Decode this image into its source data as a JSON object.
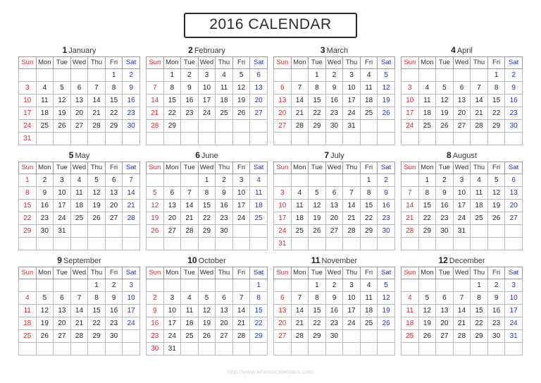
{
  "title": "2016 CALENDAR",
  "year": 2016,
  "colors": {
    "sunday": "#e8232a",
    "saturday": "#2430c8",
    "weekday": "#222222",
    "border": "#b8b8b8",
    "frame": "#2b2b2b",
    "footer": "#cfcfcf"
  },
  "weekday_headers": [
    "Sun",
    "Mon",
    "Tue",
    "Wed",
    "Thu",
    "Fri",
    "Sat"
  ],
  "footer": {
    "url": "http://www.wheniscalendars.com"
  },
  "months": [
    {
      "number": "1",
      "name": "January",
      "first_weekday": 5,
      "days_in_month": 31,
      "weeks": [
        [
          "",
          "",
          "",
          "",
          "",
          "1",
          "2"
        ],
        [
          "3",
          "4",
          "5",
          "6",
          "7",
          "8",
          "9"
        ],
        [
          "10",
          "11",
          "12",
          "13",
          "14",
          "15",
          "16"
        ],
        [
          "17",
          "18",
          "19",
          "20",
          "21",
          "22",
          "23"
        ],
        [
          "24",
          "25",
          "26",
          "27",
          "28",
          "29",
          "30"
        ],
        [
          "31",
          "",
          "",
          "",
          "",
          "",
          ""
        ]
      ]
    },
    {
      "number": "2",
      "name": "February",
      "first_weekday": 1,
      "days_in_month": 29,
      "weeks": [
        [
          "",
          "1",
          "2",
          "3",
          "4",
          "5",
          "6"
        ],
        [
          "7",
          "8",
          "9",
          "10",
          "11",
          "12",
          "13"
        ],
        [
          "14",
          "15",
          "16",
          "17",
          "18",
          "19",
          "20"
        ],
        [
          "21",
          "22",
          "23",
          "24",
          "25",
          "26",
          "27"
        ],
        [
          "28",
          "29",
          "",
          "",
          "",
          "",
          ""
        ],
        [
          "",
          "",
          "",
          "",
          "",
          "",
          ""
        ]
      ]
    },
    {
      "number": "3",
      "name": "March",
      "first_weekday": 2,
      "days_in_month": 31,
      "weeks": [
        [
          "",
          "",
          "1",
          "2",
          "3",
          "4",
          "5"
        ],
        [
          "6",
          "7",
          "8",
          "9",
          "10",
          "11",
          "12"
        ],
        [
          "13",
          "14",
          "15",
          "16",
          "17",
          "18",
          "19"
        ],
        [
          "20",
          "21",
          "22",
          "23",
          "24",
          "25",
          "26"
        ],
        [
          "27",
          "28",
          "29",
          "30",
          "31",
          "",
          ""
        ],
        [
          "",
          "",
          "",
          "",
          "",
          "",
          ""
        ]
      ]
    },
    {
      "number": "4",
      "name": "April",
      "first_weekday": 5,
      "days_in_month": 30,
      "weeks": [
        [
          "",
          "",
          "",
          "",
          "",
          "1",
          "2"
        ],
        [
          "3",
          "4",
          "5",
          "6",
          "7",
          "8",
          "9"
        ],
        [
          "10",
          "11",
          "12",
          "13",
          "14",
          "15",
          "16"
        ],
        [
          "17",
          "18",
          "19",
          "20",
          "21",
          "22",
          "23"
        ],
        [
          "24",
          "25",
          "26",
          "27",
          "28",
          "29",
          "30"
        ],
        [
          "",
          "",
          "",
          "",
          "",
          "",
          ""
        ]
      ]
    },
    {
      "number": "5",
      "name": "May",
      "first_weekday": 0,
      "days_in_month": 31,
      "weeks": [
        [
          "1",
          "2",
          "3",
          "4",
          "5",
          "6",
          "7"
        ],
        [
          "8",
          "9",
          "10",
          "11",
          "12",
          "13",
          "14"
        ],
        [
          "15",
          "16",
          "17",
          "18",
          "19",
          "20",
          "21"
        ],
        [
          "22",
          "23",
          "24",
          "25",
          "26",
          "27",
          "28"
        ],
        [
          "29",
          "30",
          "31",
          "",
          "",
          "",
          ""
        ],
        [
          "",
          "",
          "",
          "",
          "",
          "",
          ""
        ]
      ]
    },
    {
      "number": "6",
      "name": "June",
      "first_weekday": 3,
      "days_in_month": 30,
      "weeks": [
        [
          "",
          "",
          "",
          "1",
          "2",
          "3",
          "4"
        ],
        [
          "5",
          "6",
          "7",
          "8",
          "9",
          "10",
          "11"
        ],
        [
          "12",
          "13",
          "14",
          "15",
          "16",
          "17",
          "18"
        ],
        [
          "19",
          "20",
          "21",
          "22",
          "23",
          "24",
          "25"
        ],
        [
          "26",
          "27",
          "28",
          "29",
          "30",
          "",
          ""
        ],
        [
          "",
          "",
          "",
          "",
          "",
          "",
          ""
        ]
      ]
    },
    {
      "number": "7",
      "name": "July",
      "first_weekday": 5,
      "days_in_month": 31,
      "weeks": [
        [
          "",
          "",
          "",
          "",
          "",
          "1",
          "2"
        ],
        [
          "3",
          "4",
          "5",
          "6",
          "7",
          "8",
          "9"
        ],
        [
          "10",
          "11",
          "12",
          "13",
          "14",
          "15",
          "16"
        ],
        [
          "17",
          "18",
          "19",
          "20",
          "21",
          "22",
          "23"
        ],
        [
          "24",
          "25",
          "26",
          "27",
          "28",
          "29",
          "30"
        ],
        [
          "31",
          "",
          "",
          "",
          "",
          "",
          ""
        ]
      ]
    },
    {
      "number": "8",
      "name": "August",
      "first_weekday": 1,
      "days_in_month": 31,
      "weeks": [
        [
          "",
          "1",
          "2",
          "3",
          "4",
          "5",
          "6"
        ],
        [
          "7",
          "8",
          "9",
          "10",
          "11",
          "12",
          "13"
        ],
        [
          "14",
          "15",
          "16",
          "17",
          "18",
          "19",
          "20"
        ],
        [
          "21",
          "22",
          "23",
          "24",
          "25",
          "26",
          "27"
        ],
        [
          "28",
          "29",
          "30",
          "31",
          "",
          "",
          ""
        ],
        [
          "",
          "",
          "",
          "",
          "",
          "",
          ""
        ]
      ]
    },
    {
      "number": "9",
      "name": "September",
      "first_weekday": 4,
      "days_in_month": 30,
      "weeks": [
        [
          "",
          "",
          "",
          "",
          "1",
          "2",
          "3"
        ],
        [
          "4",
          "5",
          "6",
          "7",
          "8",
          "9",
          "10"
        ],
        [
          "11",
          "12",
          "13",
          "14",
          "15",
          "16",
          "17"
        ],
        [
          "18",
          "19",
          "20",
          "21",
          "22",
          "23",
          "24"
        ],
        [
          "25",
          "26",
          "27",
          "28",
          "29",
          "30",
          ""
        ],
        [
          "",
          "",
          "",
          "",
          "",
          "",
          ""
        ]
      ]
    },
    {
      "number": "10",
      "name": "October",
      "first_weekday": 6,
      "days_in_month": 31,
      "weeks": [
        [
          "",
          "",
          "",
          "",
          "",
          "",
          "1"
        ],
        [
          "2",
          "3",
          "4",
          "5",
          "6",
          "7",
          "8"
        ],
        [
          "9",
          "10",
          "11",
          "12",
          "13",
          "14",
          "15"
        ],
        [
          "16",
          "17",
          "18",
          "19",
          "20",
          "21",
          "22"
        ],
        [
          "23",
          "24",
          "25",
          "26",
          "27",
          "28",
          "29"
        ],
        [
          "30",
          "31",
          "",
          "",
          "",
          "",
          ""
        ]
      ]
    },
    {
      "number": "11",
      "name": "November",
      "first_weekday": 2,
      "days_in_month": 30,
      "weeks": [
        [
          "",
          "",
          "1",
          "2",
          "3",
          "4",
          "5"
        ],
        [
          "6",
          "7",
          "8",
          "9",
          "10",
          "11",
          "12"
        ],
        [
          "13",
          "14",
          "15",
          "16",
          "17",
          "18",
          "19"
        ],
        [
          "20",
          "21",
          "22",
          "23",
          "24",
          "25",
          "26"
        ],
        [
          "27",
          "28",
          "29",
          "30",
          "",
          "",
          ""
        ],
        [
          "",
          "",
          "",
          "",
          "",
          "",
          ""
        ]
      ]
    },
    {
      "number": "12",
      "name": "December",
      "first_weekday": 4,
      "days_in_month": 31,
      "weeks": [
        [
          "",
          "",
          "",
          "",
          "1",
          "2",
          "3"
        ],
        [
          "4",
          "5",
          "6",
          "7",
          "8",
          "9",
          "10"
        ],
        [
          "11",
          "12",
          "13",
          "14",
          "15",
          "16",
          "17"
        ],
        [
          "18",
          "19",
          "20",
          "21",
          "22",
          "23",
          "24"
        ],
        [
          "25",
          "26",
          "27",
          "28",
          "29",
          "30",
          "31"
        ],
        [
          "",
          "",
          "",
          "",
          "",
          "",
          ""
        ]
      ]
    }
  ]
}
